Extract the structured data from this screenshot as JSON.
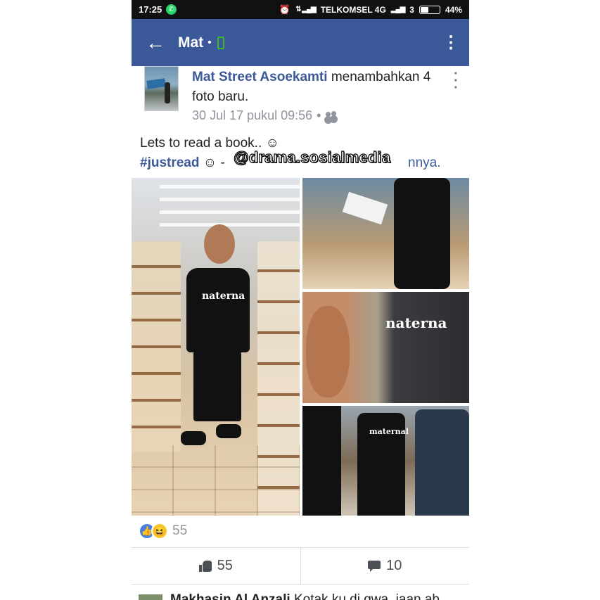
{
  "status_bar": {
    "time": "17:25",
    "carrier": "TELKOMSEL 4G",
    "sim": "3",
    "battery": "44%",
    "battery_level": 0.44
  },
  "app_bar": {
    "title": "Mat",
    "separator": "•"
  },
  "post": {
    "author": "Mat Street Asoekamti",
    "action": "menambahkan 4 foto baru.",
    "timestamp": "30 Jul 17 pukul 09:56",
    "dot": "•",
    "text_line1": "Lets to read a book.. ☺",
    "hashtag": "#justread",
    "text_line2_rest": " ☺ - ",
    "mention_tail": "nnya.",
    "watermark": "@drama.sosialmedia",
    "photo_tee_text": "naterna",
    "photo_tee_text_small": "maternal"
  },
  "reactions": {
    "like_glyph": "👍",
    "haha_glyph": "😆",
    "count": "55"
  },
  "actions": {
    "likes": "55",
    "comments": "10"
  },
  "comment_preview": {
    "name": "Makhasin Al Anzali",
    "text": " Kotak ku di gwa, jaan ab"
  }
}
